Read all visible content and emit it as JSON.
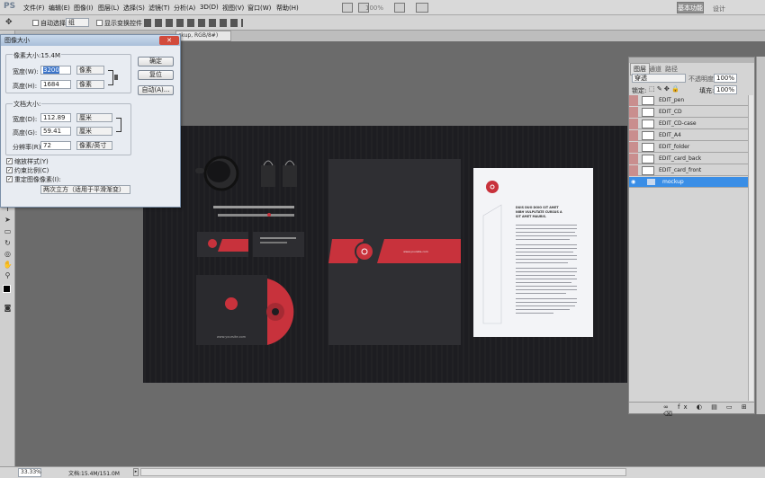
{
  "app": {
    "logo": "PS"
  },
  "menu": [
    "文件(F)",
    "编辑(E)",
    "图像(I)",
    "图层(L)",
    "选择(S)",
    "滤镜(T)",
    "分析(A)",
    "3D(D)",
    "视图(V)",
    "窗口(W)",
    "帮助(H)"
  ],
  "toolbar_top": {
    "zoom": "100%",
    "workspace": "基本功能",
    "design": "设计"
  },
  "options": {
    "auto_select": "自动选择:",
    "auto_select_value": "组",
    "show_transform": "显示变换控件"
  },
  "doc_tab": "ckup, RGB/8#)",
  "dialog": {
    "title": "图像大小",
    "pixel_size": "像素大小:15.4M",
    "width_label": "宽度(W):",
    "width_value": "3200",
    "width_unit": "像素",
    "height_label": "高度(H):",
    "height_value": "1684",
    "height_unit": "像素",
    "doc_size": "文档大小:",
    "doc_width_label": "宽度(D):",
    "doc_width_value": "112.89",
    "doc_width_unit": "厘米",
    "doc_height_label": "高度(G):",
    "doc_height_value": "59.41",
    "doc_height_unit": "厘米",
    "res_label": "分辨率(R):",
    "res_value": "72",
    "res_unit": "像素/英寸",
    "scale_styles": "缩放样式(Y)",
    "constrain": "约束比例(C)",
    "resample": "重定图像像素(I):",
    "method": "两次立方（适用于平滑渐变）",
    "ok": "确定",
    "reset": "复位",
    "auto": "自动(A)..."
  },
  "layers": {
    "tabs": [
      "图层",
      "通道",
      "路径"
    ],
    "mode": "穿透",
    "opacity_label": "不透明度:",
    "opacity": "100%",
    "lock_label": "锁定:",
    "fill_label": "填充:",
    "fill": "100%",
    "items": [
      {
        "name": "EDIT_pen",
        "selected": false
      },
      {
        "name": "EDIT_CD",
        "selected": false
      },
      {
        "name": "EDIT_CD-case",
        "selected": false
      },
      {
        "name": "EDIT_A4",
        "selected": false
      },
      {
        "name": "EDIT_folder",
        "selected": false
      },
      {
        "name": "EDIT_card_back",
        "selected": false
      },
      {
        "name": "EDIT_card_front",
        "selected": false
      },
      {
        "name": "mockup",
        "selected": true
      }
    ]
  },
  "mockup": {
    "card_text": "www.yoursite.com",
    "letter_heading": "DUIS DUO DOIO SIT AMET NIBH VULPUTATE CURSUS A SIT AMET MAURIS.",
    "accent": "#c8323c"
  },
  "status": {
    "zoom": "33.33%",
    "doc": "文档:15.4M/151.0M"
  }
}
